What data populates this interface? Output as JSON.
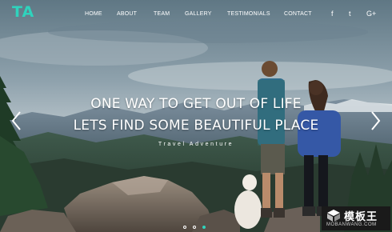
{
  "brand": {
    "logo": "TA",
    "accent": "#2fd3bd"
  },
  "nav": {
    "items": [
      "HOME",
      "ABOUT",
      "TEAM",
      "GALLERY",
      "TESTIMONIALS",
      "CONTACT"
    ]
  },
  "social": [
    {
      "icon": "facebook-icon",
      "glyph": "f"
    },
    {
      "icon": "twitter-icon",
      "glyph": "t"
    },
    {
      "icon": "google-plus-icon",
      "glyph": "G+"
    }
  ],
  "slider": {
    "line1": "ONE WAY TO GET OUT OF LIFE",
    "line2": "LETS FIND SOME BEAUTIFUL PLACE",
    "tagline": "Travel Adventure",
    "slide_count": 3,
    "active_slide": 3
  },
  "watermark": {
    "brand_cn": "模板王",
    "url": "MOBANWANG.COM"
  }
}
